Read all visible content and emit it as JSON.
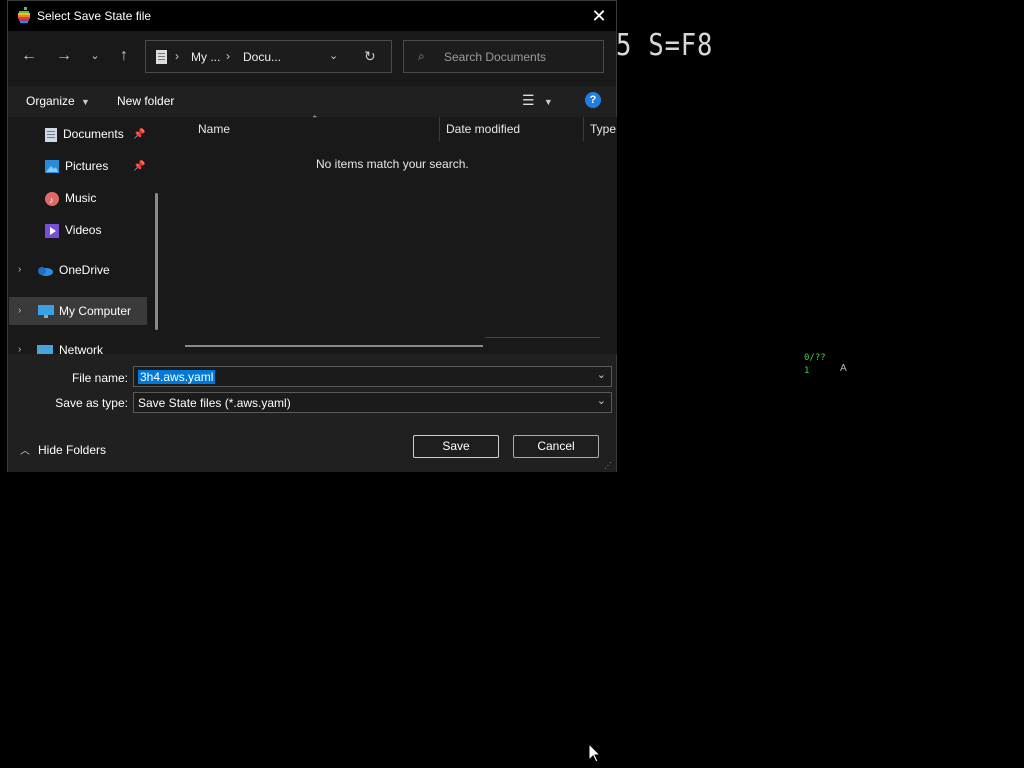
{
  "background": {
    "emulator_text": "5 S=F8",
    "status_line1": "0/??",
    "status_line2": "1",
    "status_letter": "A"
  },
  "dialog": {
    "title": "Select Save State file",
    "close_glyph": "✕",
    "address": {
      "segments": [
        "My ...",
        "Docu..."
      ]
    },
    "search_placeholder": "Search Documents",
    "toolbar": {
      "organize": "Organize",
      "new_folder": "New folder"
    },
    "sidebar": {
      "items": [
        {
          "label": "Documents",
          "icon": "documents-icon",
          "pinned": true
        },
        {
          "label": "Pictures",
          "icon": "pictures-icon",
          "pinned": true
        },
        {
          "label": "Music",
          "icon": "music-icon",
          "pinned": false
        },
        {
          "label": "Videos",
          "icon": "videos-icon",
          "pinned": false
        },
        {
          "label": "OneDrive",
          "icon": "onedrive-icon",
          "pinned": false
        },
        {
          "label": "My Computer",
          "icon": "computer-icon",
          "pinned": false,
          "selected": true
        },
        {
          "label": "Network",
          "icon": "network-icon",
          "pinned": false
        }
      ]
    },
    "columns": [
      "Name",
      "Date modified",
      "Type"
    ],
    "empty_message": "No items match your search.",
    "file_name_label": "File name:",
    "file_name_value": "3h4.aws.yaml",
    "save_type_label": "Save as type:",
    "save_type_value": "Save State files (*.aws.yaml)",
    "hide_folders": "Hide Folders",
    "save_button": "Save",
    "cancel_button": "Cancel"
  },
  "colors": {
    "selection": "#0078d7",
    "help": "#1e7fe0"
  }
}
